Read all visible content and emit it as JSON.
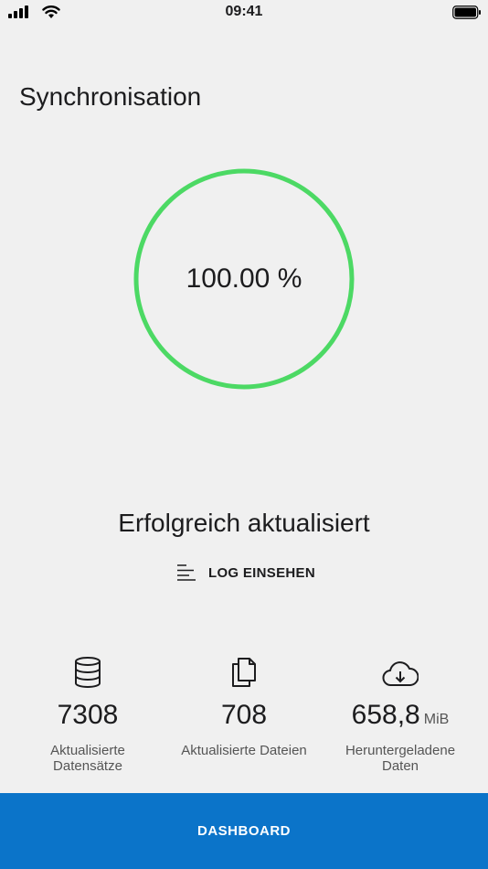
{
  "status_bar": {
    "time": "09:41"
  },
  "page": {
    "title": "Synchronisation"
  },
  "progress": {
    "display": "100.00 %",
    "fraction": 1.0,
    "color": "#4cd964"
  },
  "status_message": "Erfolgreich aktualisiert",
  "log_button": {
    "label": "LOG EINSEHEN",
    "icon": "log-lines-icon"
  },
  "stats": [
    {
      "icon": "database-icon",
      "value": "7308",
      "unit": "",
      "caption": "Aktualisierte Datensätze"
    },
    {
      "icon": "files-icon",
      "value": "708",
      "unit": "",
      "caption": "Aktualisierte Dateien"
    },
    {
      "icon": "cloud-download-icon",
      "value": "658,8",
      "unit": "MiB",
      "caption": "Heruntergeladene Daten"
    }
  ],
  "dashboard_button": {
    "label": "DASHBOARD",
    "color": "#0b74c9"
  }
}
